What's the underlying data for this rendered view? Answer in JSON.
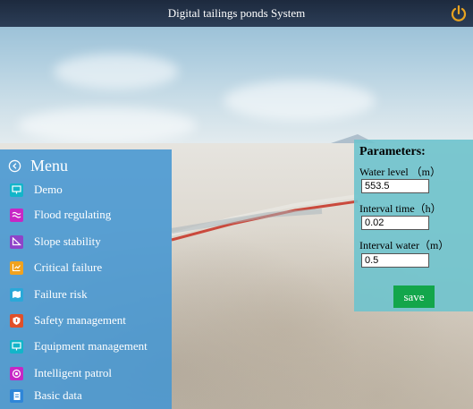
{
  "app": {
    "title": "Digital tailings ponds System",
    "power_icon": "power-icon",
    "accent": "#e8a320"
  },
  "menu": {
    "title": "Menu",
    "back_icon": "circle-arrow-left-icon",
    "items": [
      {
        "label": "Demo",
        "icon": "monitor-icon",
        "color": "#12b5c9"
      },
      {
        "label": "Flood regulating",
        "icon": "wave-icon",
        "color": "#c727c5"
      },
      {
        "label": "Slope stability",
        "icon": "slope-icon",
        "color": "#8e44c9"
      },
      {
        "label": "Critical failure",
        "icon": "chart-icon",
        "color": "#f0a21f"
      },
      {
        "label": "Failure risk",
        "icon": "map-icon",
        "color": "#2aa8d8"
      },
      {
        "label": "Safety management",
        "icon": "shield-icon",
        "color": "#e0502a"
      },
      {
        "label": "Equipment management",
        "icon": "monitor-icon",
        "color": "#12b5c9"
      },
      {
        "label": "Intelligent patrol",
        "icon": "patrol-icon",
        "color": "#c727c5"
      },
      {
        "label": "Basic data",
        "icon": "document-icon",
        "color": "#2f86d8"
      }
    ]
  },
  "params": {
    "title": "Parameters:",
    "water_level_label": "Water level （m）",
    "water_level_value": "553.5",
    "interval_time_label": "Interval time（h）",
    "interval_time_value": "0.02",
    "interval_water_label": "Interval water（m）",
    "interval_water_value": "0.5",
    "save_label": "save"
  }
}
